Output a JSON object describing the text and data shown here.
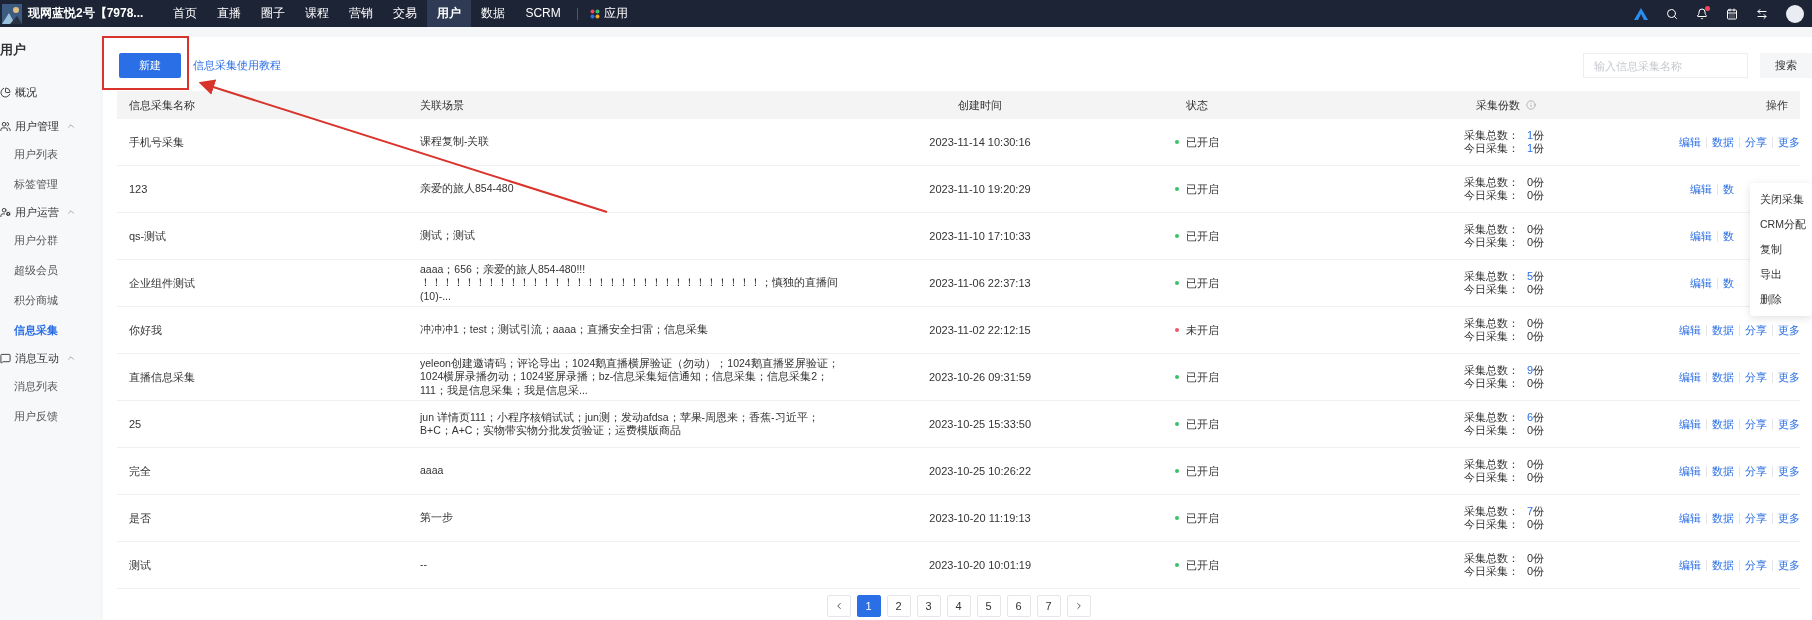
{
  "topbar": {
    "account": "现网蓝悦2号【7978...",
    "nav": [
      {
        "label": "首页",
        "selected": false
      },
      {
        "label": "直播",
        "selected": false
      },
      {
        "label": "圈子",
        "selected": false
      },
      {
        "label": "课程",
        "selected": false
      },
      {
        "label": "营销",
        "selected": false
      },
      {
        "label": "交易",
        "selected": false
      },
      {
        "label": "用户",
        "selected": true
      },
      {
        "label": "数据",
        "selected": false
      },
      {
        "label": "SCRM",
        "selected": false
      }
    ],
    "apps": "应用",
    "notification": true
  },
  "sidebar": {
    "title": "用户",
    "groups": [
      {
        "label": "概况"
      },
      {
        "label": "用户管理",
        "expanded": true,
        "children": [
          {
            "label": "用户列表",
            "selected": false
          },
          {
            "label": "标签管理",
            "selected": false
          }
        ]
      },
      {
        "label": "用户运营",
        "expanded": true,
        "children": [
          {
            "label": "用户分群",
            "selected": false
          },
          {
            "label": "超级会员",
            "selected": false
          },
          {
            "label": "积分商城",
            "selected": false
          },
          {
            "label": "信息采集",
            "selected": true
          }
        ]
      },
      {
        "label": "消息互动",
        "expanded": true,
        "children": [
          {
            "label": "消息列表",
            "selected": false
          },
          {
            "label": "用户反馈",
            "selected": false
          }
        ]
      }
    ]
  },
  "toolbar": {
    "new_button": "新建",
    "tutorial_link": "信息采集使用教程",
    "search": {
      "placeholder": "输入信息采集名称"
    },
    "search_button": "搜索"
  },
  "table": {
    "columns": [
      "信息采集名称",
      "关联场景",
      "创建时间",
      "状态",
      "采集份数",
      "操作"
    ],
    "rows": [
      {
        "name": "手机号采集",
        "scene": "课程复制-关联",
        "created": "2023-11-14 10:30:16",
        "status": {
          "label": "已开启",
          "on": true
        },
        "total": {
          "label": "采集总数：",
          "value": "1",
          "unit": "份",
          "highlighted": true
        },
        "today": {
          "label": "今日采集：",
          "value": "1",
          "unit": "份",
          "highlighted": true
        },
        "actions": [
          "编辑",
          "数据",
          "分享",
          "更多"
        ]
      },
      {
        "name": "123",
        "scene": "亲爱的旅人854-480",
        "created": "2023-11-10 19:20:29",
        "status": {
          "label": "已开启",
          "on": true
        },
        "total": {
          "label": "采集总数：",
          "value": "0",
          "unit": "份",
          "highlighted": false
        },
        "today": {
          "label": "今日采集：",
          "value": "0",
          "unit": "份",
          "highlighted": false
        },
        "actions": [
          "编辑",
          "数"
        ]
      },
      {
        "name": "qs-测试",
        "scene": "测试；测试",
        "created": "2023-11-10 17:10:33",
        "status": {
          "label": "已开启",
          "on": true
        },
        "total": {
          "label": "采集总数：",
          "value": "0",
          "unit": "份",
          "highlighted": false
        },
        "today": {
          "label": "今日采集：",
          "value": "0",
          "unit": "份",
          "highlighted": false
        },
        "actions": [
          "编辑",
          "数"
        ]
      },
      {
        "name": "企业组件测试",
        "scene": "aaaa；656；亲爱的旅人854-480!!! ！！！！！！！！！！！！！！！！！！！！！！！！！！！！！！！；慎独的直播间(10)-...",
        "created": "2023-11-06 22:37:13",
        "status": {
          "label": "已开启",
          "on": true
        },
        "total": {
          "label": "采集总数：",
          "value": "5",
          "unit": "份",
          "highlighted": true
        },
        "today": {
          "label": "今日采集：",
          "value": "0",
          "unit": "份",
          "highlighted": false
        },
        "actions": [
          "编辑",
          "数"
        ]
      },
      {
        "name": "你好我",
        "scene": "冲冲冲1；test；测试引流；aaaa；直播安全扫雷；信息采集",
        "created": "2023-11-02 22:12:15",
        "status": {
          "label": "未开启",
          "on": false
        },
        "total": {
          "label": "采集总数：",
          "value": "0",
          "unit": "份",
          "highlighted": false
        },
        "today": {
          "label": "今日采集：",
          "value": "0",
          "unit": "份",
          "highlighted": false
        },
        "actions": [
          "编辑",
          "数据",
          "分享",
          "更多"
        ]
      },
      {
        "name": "直播信息采集",
        "scene": "yeleon创建邀请码；评论导出；1024鹅直播横屏验证（勿动）；1024鹅直播竖屏验证；1024横屏录播勿动；1024竖屏录播；bz-信息采集短信通知；信息采集；信息采集2；111；我是信息采集；我是信息采...",
        "created": "2023-10-26 09:31:59",
        "status": {
          "label": "已开启",
          "on": true
        },
        "total": {
          "label": "采集总数：",
          "value": "9",
          "unit": "份",
          "highlighted": true
        },
        "today": {
          "label": "今日采集：",
          "value": "0",
          "unit": "份",
          "highlighted": false
        },
        "actions": [
          "编辑",
          "数据",
          "分享",
          "更多"
        ]
      },
      {
        "name": "25",
        "scene": "jun 详情页111；小程序核销试试；jun测；发动afdsa；苹果-周恩来；香蕉-习近平；B+C；A+C；实物带实物分批发货验证；运费模版商品",
        "created": "2023-10-25 15:33:50",
        "status": {
          "label": "已开启",
          "on": true
        },
        "total": {
          "label": "采集总数：",
          "value": "6",
          "unit": "份",
          "highlighted": true
        },
        "today": {
          "label": "今日采集：",
          "value": "0",
          "unit": "份",
          "highlighted": false
        },
        "actions": [
          "编辑",
          "数据",
          "分享",
          "更多"
        ]
      },
      {
        "name": "完全",
        "scene": "aaaa",
        "created": "2023-10-25 10:26:22",
        "status": {
          "label": "已开启",
          "on": true
        },
        "total": {
          "label": "采集总数：",
          "value": "0",
          "unit": "份",
          "highlighted": false
        },
        "today": {
          "label": "今日采集：",
          "value": "0",
          "unit": "份",
          "highlighted": false
        },
        "actions": [
          "编辑",
          "数据",
          "分享",
          "更多"
        ]
      },
      {
        "name": "是否",
        "scene": "第一步",
        "created": "2023-10-20 11:19:13",
        "status": {
          "label": "已开启",
          "on": true
        },
        "total": {
          "label": "采集总数：",
          "value": "7",
          "unit": "份",
          "highlighted": true
        },
        "today": {
          "label": "今日采集：",
          "value": "0",
          "unit": "份",
          "highlighted": false
        },
        "actions": [
          "编辑",
          "数据",
          "分享",
          "更多"
        ]
      },
      {
        "name": "测试",
        "scene": "--",
        "created": "2023-10-20 10:01:19",
        "status": {
          "label": "已开启",
          "on": true
        },
        "total": {
          "label": "采集总数：",
          "value": "0",
          "unit": "份",
          "highlighted": false
        },
        "today": {
          "label": "今日采集：",
          "value": "0",
          "unit": "份",
          "highlighted": false
        },
        "actions": [
          "编辑",
          "数据",
          "分享",
          "更多"
        ]
      }
    ]
  },
  "more_menu": [
    "关闭采集",
    "CRM分配",
    "复制",
    "导出",
    "删除"
  ],
  "pagination": {
    "pages": [
      {
        "label": "1",
        "selected": true
      },
      {
        "label": "2",
        "selected": false
      },
      {
        "label": "3",
        "selected": false
      },
      {
        "label": "4",
        "selected": false
      },
      {
        "label": "5",
        "selected": false
      },
      {
        "label": "6",
        "selected": false
      },
      {
        "label": "7",
        "selected": false
      }
    ]
  }
}
